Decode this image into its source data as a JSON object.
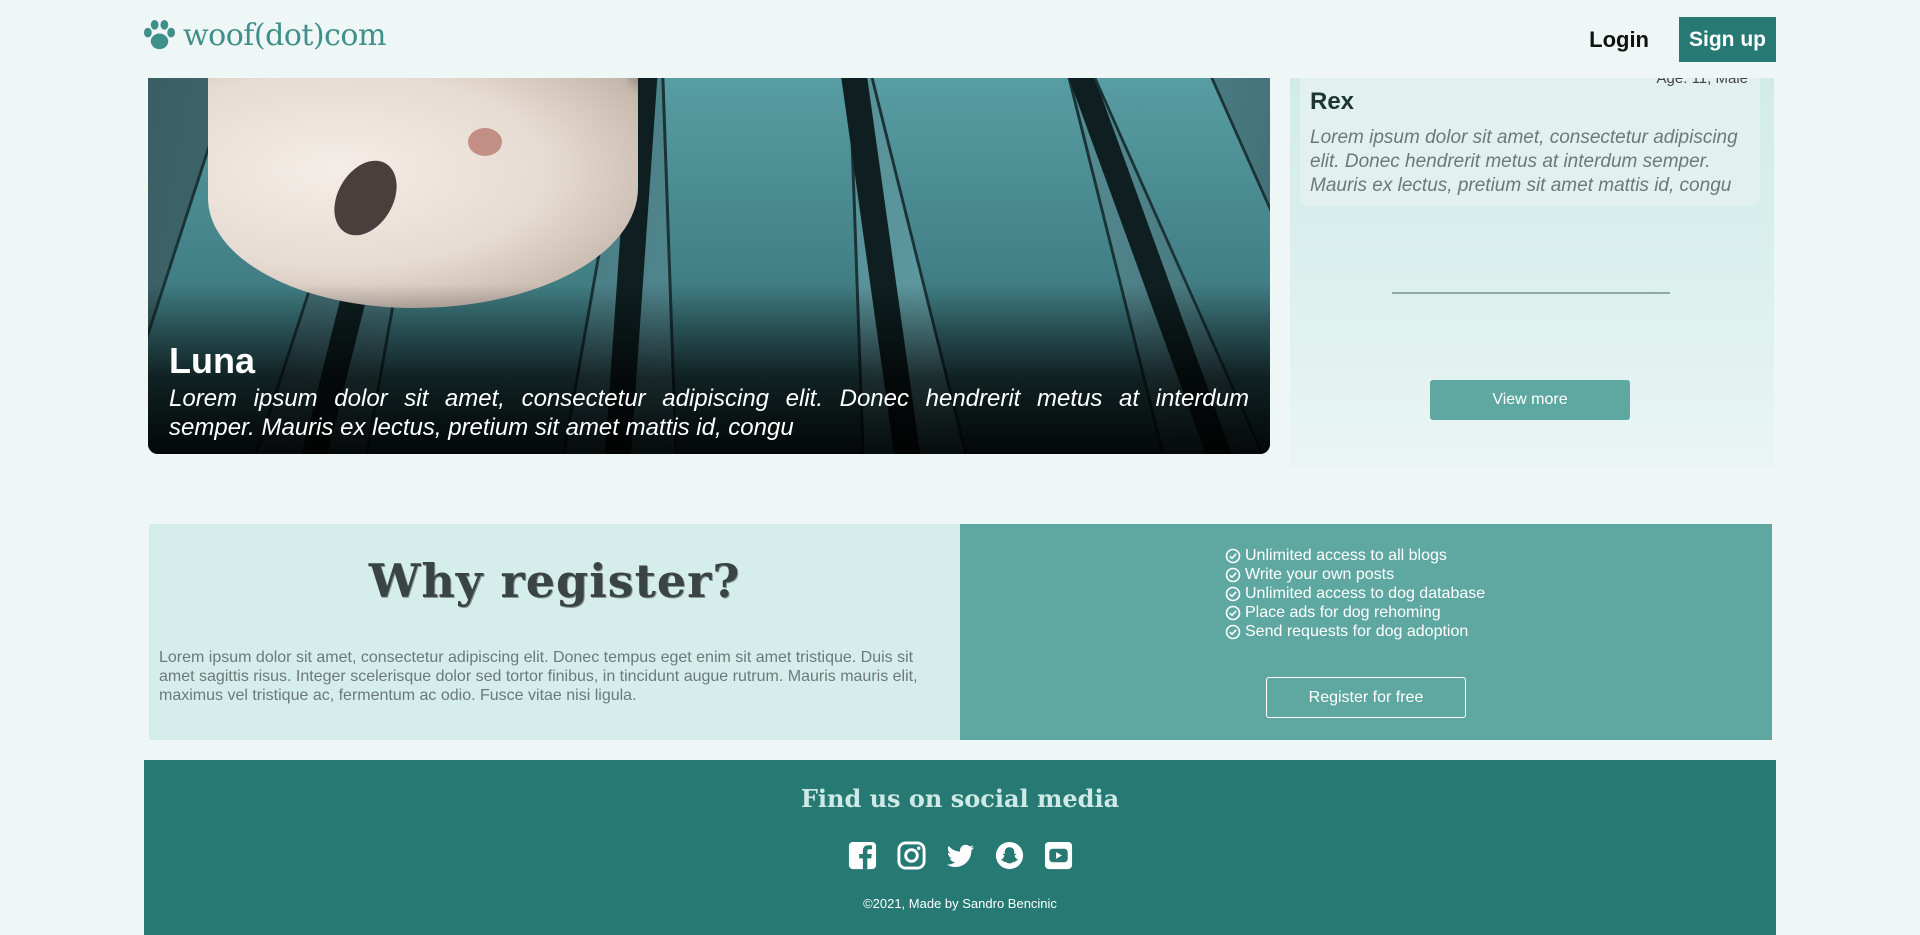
{
  "header": {
    "logo_text": "woof(dot)com",
    "login_label": "Login",
    "signup_label": "Sign up"
  },
  "hero": {
    "name": "Luna",
    "description_line1": "Lorem ipsum dolor sit amet, consectetur adipiscing elit. Donec hendrerit metus at interdum",
    "description_line2": "semper. Mauris ex lectus, pretium sit amet mattis id, congu"
  },
  "side_card": {
    "age_gender": "Age: 11, Male",
    "name": "Rex",
    "description": "Lorem ipsum dolor sit amet, consectetur adipiscing elit. Donec hendrerit metus at interdum semper. Mauris ex lectus, pretium sit amet mattis id, congu",
    "view_more_label": "View more"
  },
  "register": {
    "title": "Why register?",
    "text": "Lorem ipsum dolor sit amet, consectetur adipiscing elit. Donec tempus eget enim sit amet tristique. Duis sit amet sagittis risus. Integer scelerisque dolor sed tortor finibus, in tincidunt augue rutrum. Mauris mauris elit, maximus vel tristique ac, fermentum ac odio. Fusce vitae nisi ligula.",
    "benefits": [
      "Unlimited access to all blogs",
      "Write your own posts",
      "Unlimited access to dog database",
      "Place ads for dog rehoming",
      "Send requests for dog adoption"
    ],
    "button_label": "Register for free"
  },
  "footer": {
    "title": "Find us on social media",
    "socials": [
      "facebook-icon",
      "instagram-icon",
      "twitter-icon",
      "snapchat-icon",
      "youtube-icon"
    ],
    "copyright": "©2021, Made by Sandro Bencinic"
  },
  "colors": {
    "background": "#eef7f6",
    "primary_dark": "#267a73",
    "primary": "#5fa8a1",
    "logo": "#3f8f8a"
  }
}
